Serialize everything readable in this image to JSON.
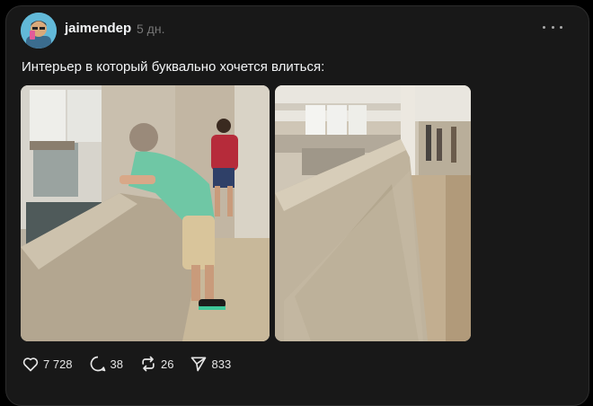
{
  "post": {
    "username": "jaimendep",
    "time": "5 дн.",
    "text": "Интерьер в который буквально хочется влиться:"
  },
  "stats": {
    "likes": "7 728",
    "comments": "38",
    "reposts": "26",
    "shares": "833"
  },
  "icons": {
    "more": "more-dots-icon",
    "like": "heart-icon",
    "comment": "speech-bubble-icon",
    "repost": "repost-arrows-icon",
    "share": "paper-plane-icon"
  },
  "colors": {
    "background": "#000000",
    "card": "#181818",
    "text": "#f3f5f7",
    "muted": "#777777"
  }
}
